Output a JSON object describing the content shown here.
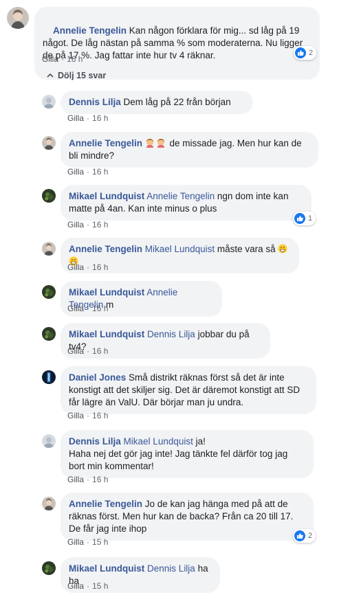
{
  "actions": {
    "like_label": "Gilla",
    "separator": "·"
  },
  "toggle_replies_label": "Dölj 15 svar",
  "main_comment": {
    "author": "Annelie Tengelin",
    "text": " Kan någon förklara för mig... sd låg på 19 något. De låg nästan på samma % som moderaterna. Nu ligger de på 17 %. Jag fattar inte hur tv 4 räknar.",
    "time": "16 h",
    "reaction_count": "2",
    "avatar": "annelie-avatar"
  },
  "replies": [
    {
      "author": "Dennis Lilja",
      "mention": "",
      "text": " Dem låg på 22 från början",
      "time": "16 h",
      "reaction_count": ""
    },
    {
      "author": "Annelie Tengelin",
      "mention": "",
      "text": " de missade jag. Men hur kan de bli mindre?",
      "emoji": [
        "woman-shrugging-emoji",
        "woman-shrugging-emoji"
      ],
      "time": "16 h",
      "reaction_count": ""
    },
    {
      "author": "Mikael Lundquist",
      "mention": "Annelie Tengelin",
      "text": " ngn dom inte kan matte på 4an. Kan inte minus o plus",
      "time": "16 h",
      "reaction_count": "1"
    },
    {
      "author": "Annelie Tengelin",
      "mention": "Mikael Lundquist",
      "text": " måste vara så",
      "emoji_after": [
        "grinning-face-emoji",
        "grinning-face-emoji"
      ],
      "time": "16 h",
      "reaction_count": ""
    },
    {
      "author": "Mikael Lundquist",
      "mention": "Annelie Tengelin",
      "text": " m",
      "time": "16 h",
      "reaction_count": ""
    },
    {
      "author": "Mikael Lundquist",
      "mention": "Dennis Lilja",
      "text": " jobbar du på tv4?",
      "time": "16 h",
      "reaction_count": ""
    },
    {
      "author": "Daniel Jones",
      "mention": "",
      "text": " Små distrikt räknas först så det är inte konstigt att det skiljer sig. Det är däremot konstigt att SD får lägre än ValU. Där börjar man ju undra.",
      "time": "16 h",
      "reaction_count": ""
    },
    {
      "author": "Dennis Lilja",
      "mention": "Mikael Lundquist",
      "text": " ja!\nHaha nej det gör jag inte! Jag tänkte fel därför tog jag bort min kommentar!",
      "time": "16 h",
      "reaction_count": ""
    },
    {
      "author": "Annelie Tengelin",
      "mention": "",
      "text": " Jo de kan jag hänga med på att de räknas först. Men hur kan de backa? Från ca 20 till 17. De får jag inte ihop",
      "time": "15 h",
      "reaction_count": "2"
    },
    {
      "author": "Mikael Lundquist",
      "mention": "Dennis Lilja",
      "text": " ha ha",
      "time": "15 h",
      "reaction_count": ""
    }
  ],
  "colors": {
    "link": "#385898",
    "bubble": "#f2f3f5",
    "like_blue": "#1877f2",
    "meta": "#616770"
  }
}
